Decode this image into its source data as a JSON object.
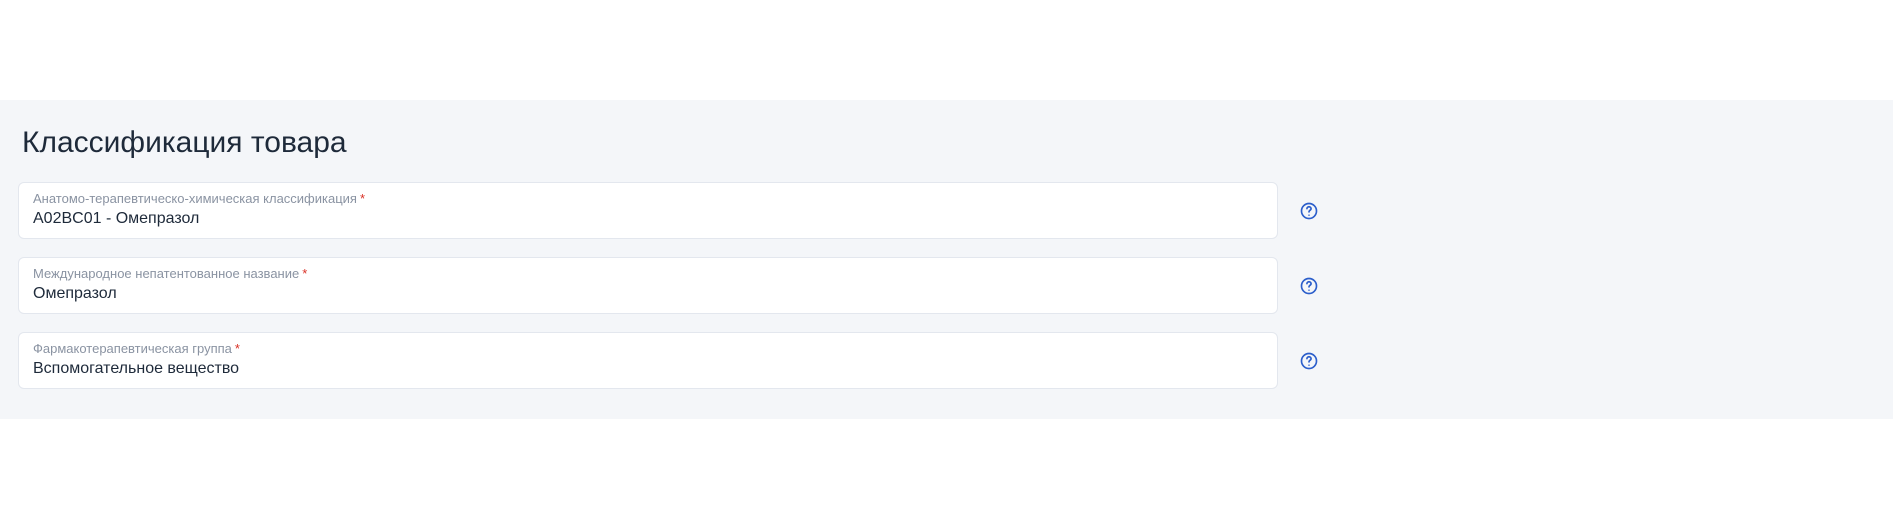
{
  "section": {
    "title": "Классификация товара"
  },
  "fields": {
    "atc": {
      "label": "Анатомо-терапевтическо-химическая классификация",
      "required": "*",
      "value": "A02BC01 - Омепразол"
    },
    "inn": {
      "label": "Международное непатентованное название",
      "required": "*",
      "value": "Омепразол"
    },
    "pharmgroup": {
      "label": "Фармакотерапевтическая группа",
      "required": "*",
      "value": "Вспомогательное вещество"
    }
  }
}
